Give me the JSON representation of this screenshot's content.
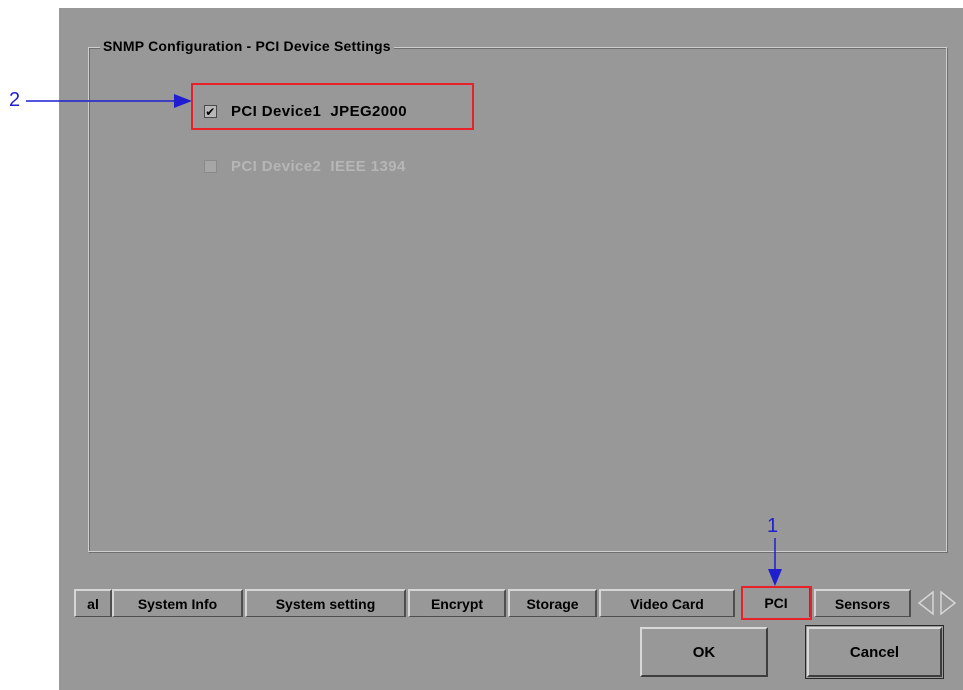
{
  "dialog": {
    "group_title": "SNMP Configuration - PCI Device Settings",
    "devices": [
      {
        "label": "PCI Device1  JPEG2000",
        "checked": true,
        "enabled": true
      },
      {
        "label": "PCI Device2  IEEE 1394",
        "checked": false,
        "enabled": false
      }
    ]
  },
  "tabs": [
    {
      "label": "al"
    },
    {
      "label": "System Info"
    },
    {
      "label": "System setting"
    },
    {
      "label": "Encrypt"
    },
    {
      "label": "Storage"
    },
    {
      "label": "Video Card"
    },
    {
      "label": "PCI",
      "active": true
    },
    {
      "label": "Sensors"
    }
  ],
  "buttons": {
    "ok": "OK",
    "cancel": "Cancel"
  },
  "callouts": {
    "one": "1",
    "two": "2"
  },
  "colors": {
    "panel": "#989898",
    "highlight": "#e8202a",
    "callout": "#1f1fd0"
  },
  "icons": {
    "check": "✔",
    "scroll_left": "arrow-left-icon",
    "scroll_right": "arrow-right-icon"
  }
}
